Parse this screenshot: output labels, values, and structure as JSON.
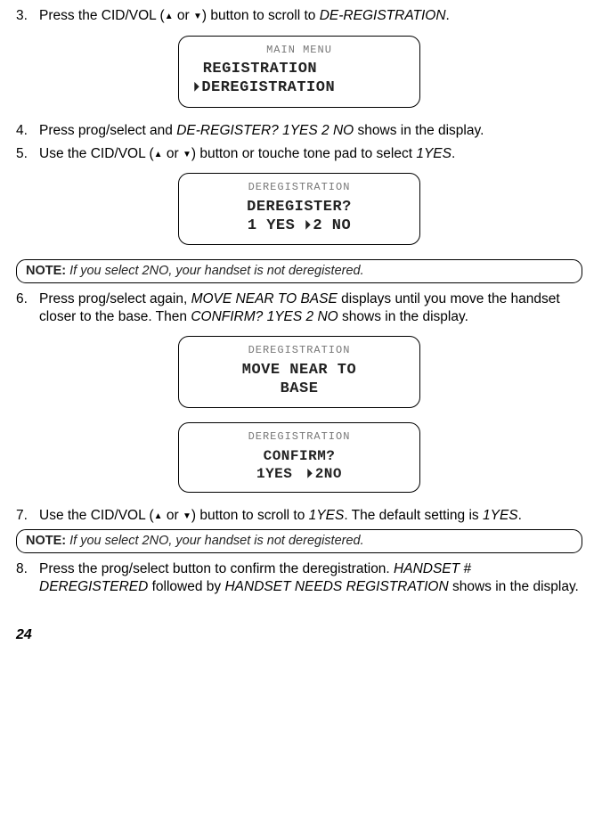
{
  "steps": {
    "s3": {
      "num": "3.",
      "pre": "Press the CID/VOL (",
      "mid": " or ",
      "post": ") button to scroll to ",
      "tail": "DE-REGISTRATION",
      "end": "."
    },
    "s4": {
      "num": "4.",
      "pre": "Press prog/select and ",
      "tail": "DE-REGISTER? 1YES 2 NO",
      "post": " shows in the display."
    },
    "s5": {
      "num": "5.",
      "pre": "Use the CID/VOL (",
      "mid": " or ",
      "post": ") button or touche tone pad to select ",
      "tail": "1YES",
      "end": "."
    },
    "s6": {
      "num": "6.",
      "pre": "Press prog/select again, ",
      "m1": "MOVE NEAR TO BASE",
      "mid": " displays until you move the handset closer to the base. Then ",
      "m2": "CONFIRM? 1YES 2 NO",
      "post": " shows in the display."
    },
    "s7": {
      "num": "7.",
      "pre": "Use the CID/VOL (",
      "mid": " or ",
      "post": ") button to scroll to ",
      "tail": "1YES",
      "mid2": ". The default setting is ",
      "tail2": "1YES",
      "end": "."
    },
    "s8": {
      "num": "8.",
      "pre": "Press the prog/select button to confirm the deregistration. ",
      "m1": "HANDSET # DEREGISTERED",
      "mid": " followed by ",
      "m2": "HANDSET NEEDS REGISTRATION",
      "post": " shows in the display."
    }
  },
  "arrows": {
    "up": "▲",
    "down": "▼",
    "tri": "▶"
  },
  "screen1": {
    "title": "MAIN MENU",
    "l1": " REGISTRATION",
    "l2": "DEREGISTRATION"
  },
  "screen2": {
    "title": "DEREGISTRATION",
    "l1": "DEREGISTER?",
    "l2a": "1 YES ",
    "l2b": "2 NO"
  },
  "screen3": {
    "title": "DEREGISTRATION",
    "l1": "MOVE NEAR TO",
    "l2": "BASE"
  },
  "screen4": {
    "title": "DEREGISTRATION",
    "l1": "CONFIRM?",
    "l2a": "1YES",
    "l2b": "2NO"
  },
  "note1": {
    "label": "NOTE:",
    "pre": " If you select ",
    "val": "2NO",
    "post": ", your handset is not deregistered."
  },
  "note2": {
    "label": "NOTE:",
    "pre": " If you select ",
    "val": "2NO",
    "post": ", your handset is not deregistered."
  },
  "page": "24"
}
